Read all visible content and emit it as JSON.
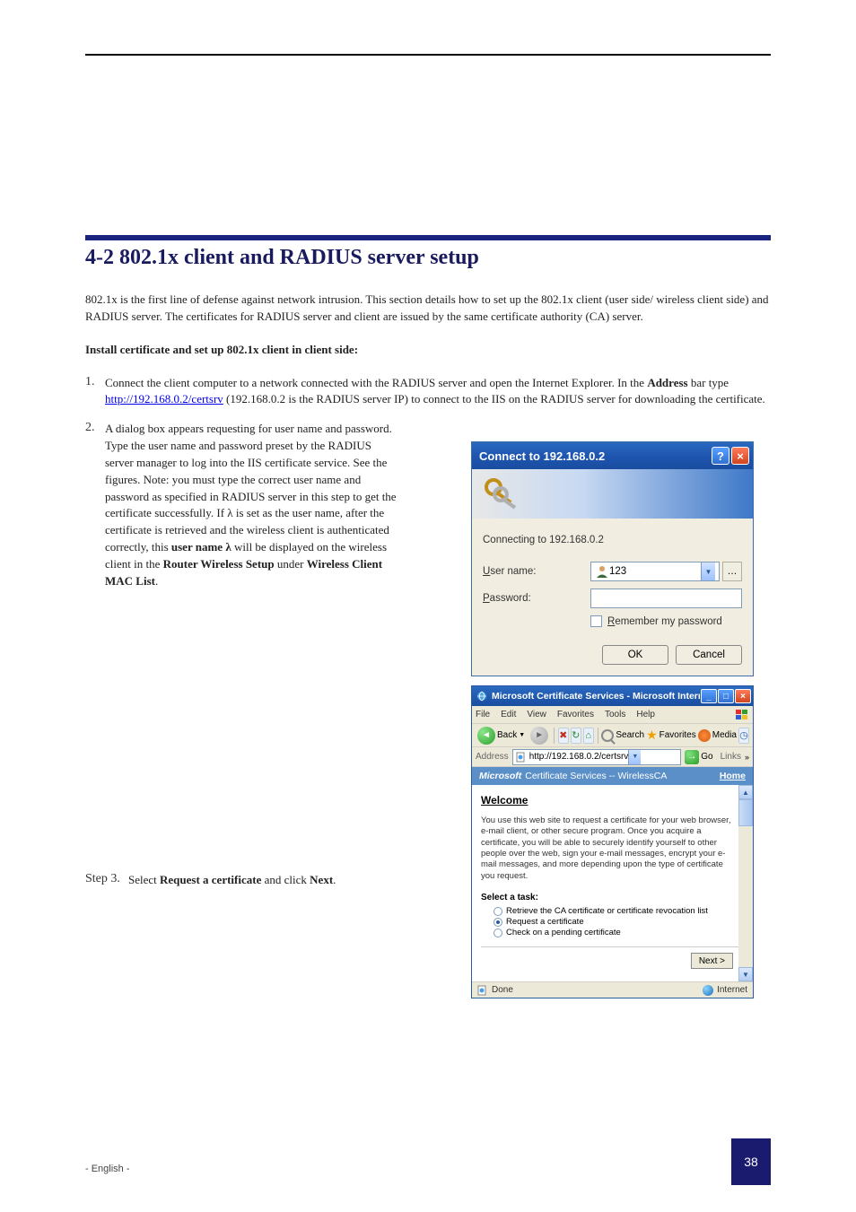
{
  "section": {
    "heading": "4-2 802.1x client and RADIUS server setup"
  },
  "intro": "802.1x is the first line of defense against network intrusion. This section details how to set up the 802.1x client (user side/ wireless client side) and RADIUS server. The certificates for RADIUS server and client are issued by the same certificate authority (CA) server.",
  "subhead": "Install certificate and set up 802.1x client in client side:",
  "step1_prefix": "Connect the client computer to a network connected with the RADIUS server and open the Internet Explorer. In the ",
  "step1_bold": "Address",
  "step1_mid": " bar type ",
  "step1_url": "http://192.168.0.2/certsrv",
  "step1_tail": " (192.168.0.2 is the RADIUS server IP) to connect to the IIS on the RADIUS server for downloading the certificate.",
  "step2_prefix": "A dialog box appears requesting for user name and password. Type the user name and password preset by the RADIUS server manager to log into the IIS certificate service. See the figures. Note: you must type the correct user name and password as specified in RADIUS server in this step to get the certificate successfully. If λ is set as the user name, after the certificate is retrieved and the wireless client is authenticated correctly, this ",
  "step2_bold": "user name λ",
  "step2_mid": " will be displayed on the wireless client in the ",
  "step2_bold2": "Router Wireless Setup",
  "step2_mid2": " under ",
  "step2_bold3": "Wireless Client MAC List",
  "step2_tail": ".",
  "step3_prefix": "Select ",
  "step3_bold": "Request a certificate",
  "step3_mid": " and click ",
  "step3_bold2": "Next",
  "step3_tail": ".",
  "dlg1": {
    "title": "Connect to 192.168.0.2",
    "connecting": "Connecting to 192.168.0.2",
    "username_label": "User name:",
    "password_label": "Password:",
    "username_value": "123",
    "remember": "Remember my password",
    "ok": "OK",
    "cancel": "Cancel"
  },
  "win2": {
    "title": "Microsoft Certificate Services - Microsoft Internet Explorer",
    "menu": {
      "file": "File",
      "edit": "Edit",
      "view": "View",
      "favorites": "Favorites",
      "tools": "Tools",
      "help": "Help"
    },
    "toolbar": {
      "back": "Back",
      "search": "Search",
      "favorites": "Favorites",
      "media": "Media"
    },
    "addr_label": "Address",
    "address": "http://192.168.0.2/certsrv",
    "go": "Go",
    "links": "Links",
    "banner_ms": "Microsoft",
    "banner_text": " Certificate Services  --  WirelessCA",
    "home": "Home",
    "welcome": "Welcome",
    "desc": "You use this web site to request a certificate for your web browser, e-mail client, or other secure program. Once you acquire a certificate, you will be able to securely identify yourself to other people over the web, sign your e-mail messages, encrypt your e-mail messages, and more depending upon the type of certificate you request.",
    "task_head": "Select a task:",
    "opt1": "Retrieve the CA certificate or certificate revocation list",
    "opt2": "Request a certificate",
    "opt3": "Check on a pending certificate",
    "next": "Next >",
    "status_done": "Done",
    "status_zone": "Internet"
  },
  "footer": {
    "left": "- English -",
    "page": "38"
  }
}
